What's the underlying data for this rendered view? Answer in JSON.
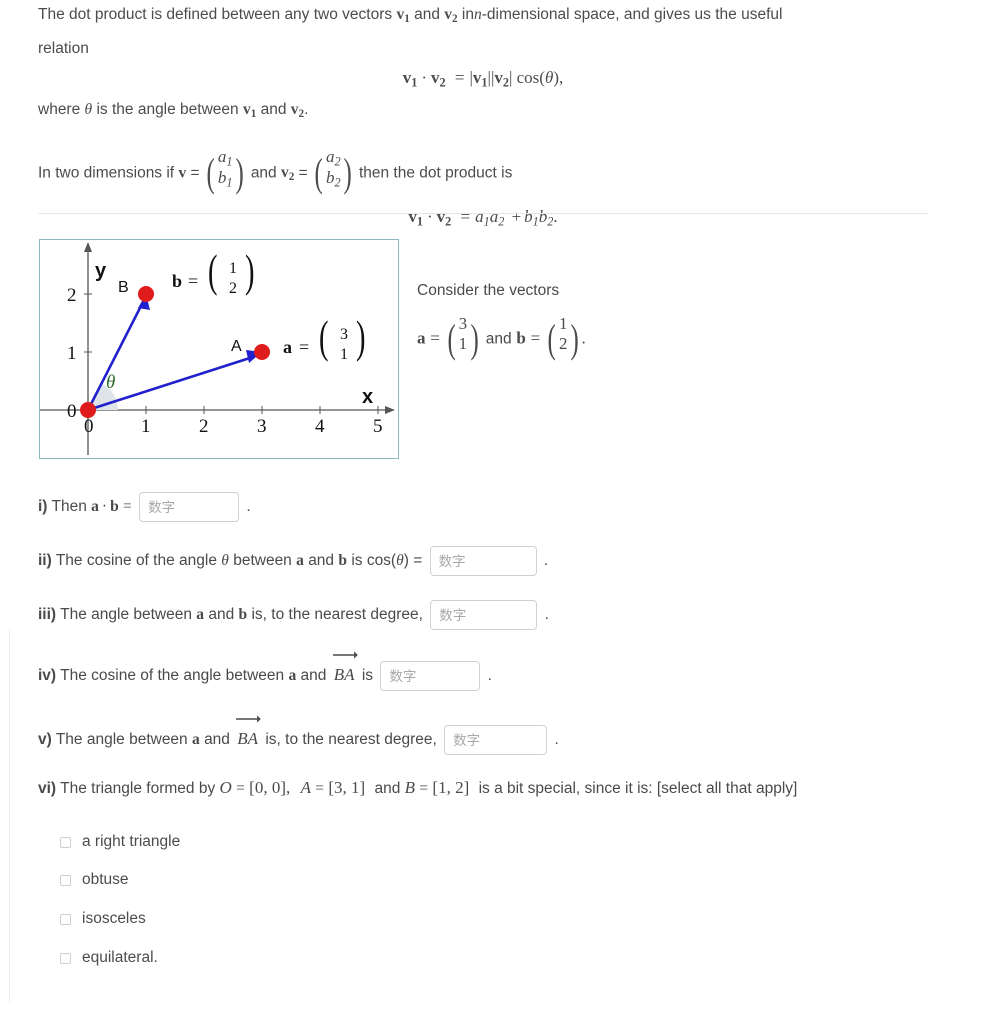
{
  "intro": {
    "line1_a": "The dot product is defined between any two vectors",
    "line1_v1": "v",
    "line1_sub1": "1",
    "line1_and": "and",
    "line1_v2": "v",
    "line1_sub2": "2",
    "line1_b": "in",
    "line1_n": "n",
    "line1_c": "-dimensional space, and gives us the useful",
    "line2": "relation",
    "eq1": "v₁ · v₂ = |v₁| |v₂| cos(θ),",
    "eq1_parts": {
      "v": "v",
      "one": "1",
      "two": "2",
      "dot": "·",
      "eq": "=",
      "bar": "|",
      "cos": "cos(",
      "theta": "θ",
      "closeparen": "),"
    },
    "line3_a": "where",
    "line3_theta": "θ",
    "line3_b": "is the angle between",
    "line3_c": "and",
    "line3_period": ".",
    "line4_a": "In two dimensions if",
    "line4_v": "v",
    "line4_eq": "=",
    "line4_vec1_top": "a",
    "line4_vec1_top_sub": "1",
    "line4_vec1_bot": "b",
    "line4_vec1_bot_sub": "1",
    "line4_and": "and",
    "line4_v2": "v",
    "line4_v2_sub": "2",
    "line4_vec2_top": "a",
    "line4_vec2_top_sub": "2",
    "line4_vec2_bot": "b",
    "line4_vec2_bot_sub": "2",
    "line4_b": "then the dot product is",
    "eq2": "v₁ · v₂ = a₁a₂ + b₁b₂.",
    "eq2_parts": {
      "a": "a",
      "b": "b",
      "plus": "+",
      "period": "."
    }
  },
  "graph": {
    "x_ticks": [
      "0",
      "1",
      "2",
      "3",
      "4",
      "5"
    ],
    "y_ticks": [
      "0",
      "1",
      "2"
    ],
    "x_axis_label": "x",
    "y_axis_label": "y",
    "origin_label": "0",
    "point_a_label": "A",
    "point_b_label": "B",
    "theta_label": "θ",
    "vec_a_name": "a",
    "vec_a_top": "3",
    "vec_a_bot": "1",
    "vec_b_name": "b",
    "vec_b_top": "1",
    "vec_b_bot": "2",
    "equals": "=",
    "points": [
      {
        "name": "O",
        "x": 0,
        "y": 0
      },
      {
        "name": "A",
        "x": 3,
        "y": 1
      },
      {
        "name": "B",
        "x": 1,
        "y": 2
      }
    ],
    "colors": {
      "vector": "#2020cc",
      "point": "#e01b1b",
      "theta": "#2d6b2d",
      "arc_fill": "#dfe4e8",
      "axis": "#555555",
      "border": "#8fb6c4"
    }
  },
  "consider": {
    "title": "Consider the vectors",
    "a_name": "a",
    "equals": "=",
    "a_top": "3",
    "a_bot": "1",
    "and": "and",
    "b_name": "b",
    "b_top": "1",
    "b_bot": "2",
    "period": "."
  },
  "questions": [
    {
      "label": "i)",
      "text_before": "Then",
      "bold_a": "a",
      "dot": "·",
      "bold_b": "b",
      "equals": "=",
      "placeholder": "数字",
      "value": "",
      "text_after": ".",
      "input_width": 100
    },
    {
      "label": "ii)",
      "text_before": "The cosine of the angle",
      "theta": "θ",
      "between": "between",
      "bold_a": "a",
      "and": "and",
      "bold_b": "b",
      "is": "is cos(",
      "theta2": "θ",
      "equals": ") =",
      "placeholder": "数字",
      "value": "",
      "text_after": ".",
      "input_width": 107
    },
    {
      "label": "iii)",
      "text_before": "The angle between",
      "bold_a": "a",
      "and": "and",
      "bold_b": "b",
      "is": "is, to the nearest degree,",
      "placeholder": "数字",
      "value": "",
      "text_after": ".",
      "input_width": 107
    },
    {
      "label": "iv)",
      "text_before": "The cosine of the angle between",
      "bold_a": "a",
      "and": "and",
      "ba": "BA",
      "is": "is",
      "placeholder": "数字",
      "value": "",
      "text_after": ".",
      "input_width": 100
    },
    {
      "label": "v)",
      "text_before": "The angle between",
      "bold_a": "a",
      "and": "and",
      "ba": "BA",
      "is": "is, to the nearest degree,",
      "placeholder": "数字",
      "value": "",
      "text_after": ".",
      "input_width": 103
    }
  ],
  "question_vi": {
    "label": "vi)",
    "t1": "The triangle formed by",
    "o": "O",
    "eq": "=",
    "o_val": "[0, 0],",
    "a": "A",
    "a_val": "[3, 1]",
    "and": "and",
    "b": "B",
    "b_val": "[1, 2]",
    "t2": "is a bit special, since it is: [select all that apply]"
  },
  "options": [
    {
      "label": "a right triangle",
      "checked": false
    },
    {
      "label": "obtuse",
      "checked": false
    },
    {
      "label": "isosceles",
      "checked": false
    },
    {
      "label": "equilateral.",
      "checked": false
    }
  ]
}
